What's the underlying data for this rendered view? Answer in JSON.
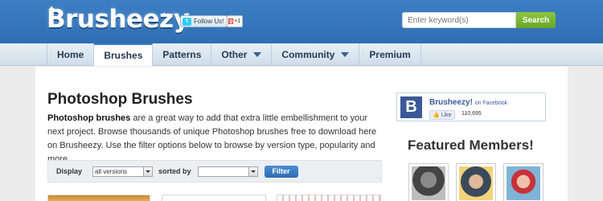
{
  "header": {
    "logo": "Brusheezy",
    "follow_label": "Follow Us!",
    "gplus_label": "+1",
    "search": {
      "placeholder": "Enter keyword(s)",
      "button_label": "Search"
    }
  },
  "nav": {
    "items": [
      {
        "label": "Home"
      },
      {
        "label": "Brushes"
      },
      {
        "label": "Patterns"
      },
      {
        "label": "Other"
      },
      {
        "label": "Community"
      },
      {
        "label": "Premium"
      }
    ]
  },
  "main": {
    "title": "Photoshop Brushes",
    "intro_bold": "Photoshop brushes",
    "intro_rest": " are a great way to add that extra little embellishment to your next project. Browse thousands of unique Photoshop brushes free to download here on Brusheezy. Use the filter options below to browse by version type, popularity and more.",
    "filter": {
      "display_label": "Display",
      "display_value": "all versions",
      "sorted_label": "sorted by",
      "sorted_value": "",
      "button_label": "Filter"
    }
  },
  "sidebar": {
    "facebook": {
      "name": "Brusheezy!",
      "on_label": "on Facebook",
      "like_label": "Like",
      "like_count": "110,695"
    },
    "featured_title": "Featured Members!"
  },
  "colors": {
    "header_blue": "#3d7fc3",
    "search_green": "#8cc63f",
    "facebook_blue": "#3b5998"
  }
}
